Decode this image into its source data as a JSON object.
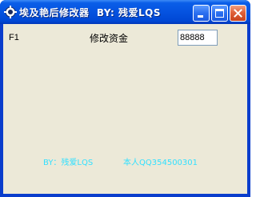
{
  "window": {
    "title": "埃及艳后修改器  BY: 残爱LQS",
    "app_icon": "gear-app-icon",
    "controls": {
      "minimize_icon": "minimize-icon",
      "maximize_icon": "maximize-icon",
      "close_icon": "close-icon"
    }
  },
  "form": {
    "hotkey": "F1",
    "money_label": "修改资金",
    "money_value": "88888"
  },
  "footer": {
    "credit": "BY：残爱LQS",
    "qq": "本人QQ354500301"
  },
  "colors": {
    "titlebar": "#0553e0",
    "client_bg": "#ece9d8",
    "footer_text": "#33e0ff",
    "close_button": "#e0613a"
  }
}
